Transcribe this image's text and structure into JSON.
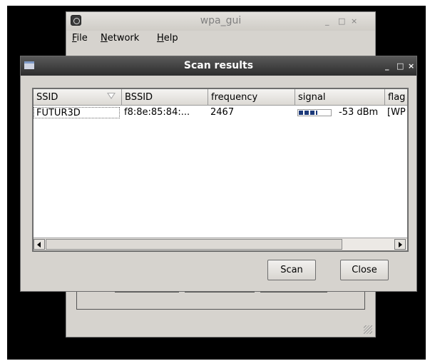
{
  "main_window": {
    "title": "wpa_gui",
    "minimize": "_",
    "maximize": "□",
    "close": "×",
    "menu": {
      "file": {
        "key": "F",
        "rest": "ile"
      },
      "network": {
        "key": "N",
        "rest": "etwork"
      },
      "help": {
        "key": "H",
        "rest": "elp"
      }
    }
  },
  "dialog": {
    "title": "Scan results",
    "minimize": "_",
    "maximize": "□",
    "close": "×",
    "table": {
      "headers": [
        "SSID",
        "BSSID",
        "frequency",
        "signal",
        "flag"
      ],
      "rows": [
        {
          "ssid": "FUTUR3D",
          "bssid": "f8:8e:85:84:...",
          "frequency": "2467",
          "signal_text": "-53 dBm",
          "signal_level": 0.6,
          "flags": "[WP"
        }
      ]
    },
    "buttons": {
      "scan": "Scan",
      "close": "Close"
    }
  },
  "colors": {
    "signal_bar": "#1d3a7a",
    "dialog_titlebar": "#3a3a3a"
  }
}
